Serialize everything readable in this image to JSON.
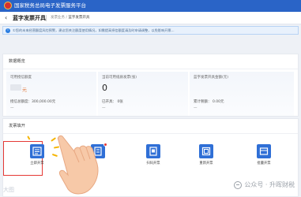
{
  "header": {
    "app_title": "国家税务总局电子发票服务平台"
  },
  "toolbar": {
    "back_icon": "chevron-left-icon",
    "page_title": "蓝字发票开具",
    "breadcrumb": [
      {
        "label": "发票业务"
      },
      {
        "label": "蓝字发票开具"
      }
    ],
    "breadcrumb_sep": "/"
  },
  "notice": {
    "icon": "info-icon",
    "text": "①您的未来经营额度风险预警，建议您关注额度使用情况，如需提高授信额度请及时申请调整，以免影响开票..."
  },
  "overview": {
    "title": "数据概览",
    "cards": [
      {
        "label": "可用授信额度",
        "value": "",
        "unit": "元",
        "sub1": "授信总额度：300,000.00元",
        "sub2": "—"
      },
      {
        "label": "当前可用纸质发票(张)",
        "value": "0",
        "sub1": "已开具：",
        "sub1_value": "0张",
        "sub2": "—"
      },
      {
        "label": "蓝字发票开具金额(元)",
        "value": "",
        "sub1": "累计税额：",
        "sub1_value": "0.00元",
        "sub2": "—"
      }
    ]
  },
  "quick_actions": {
    "title": "发票填开",
    "tiles": [
      {
        "label": "立即开票",
        "icon": "invoice-issue-icon"
      },
      {
        "label": "",
        "icon": "invoice-template-icon"
      },
      {
        "label": "扫码开票",
        "icon": "scan-invoice-icon"
      },
      {
        "label": "重新开票",
        "icon": "reissue-invoice-icon"
      },
      {
        "label": "批量开票",
        "icon": "batch-invoice-icon"
      }
    ]
  },
  "overlay": {
    "hand_icon": "pointing-hand-icon",
    "watermark": "公众号 · 升晖财税",
    "corner_text": "大图"
  },
  "colors": {
    "brand_blue": "#2a64c7",
    "accent_red": "#e53935",
    "warning_orange": "#e07030"
  }
}
